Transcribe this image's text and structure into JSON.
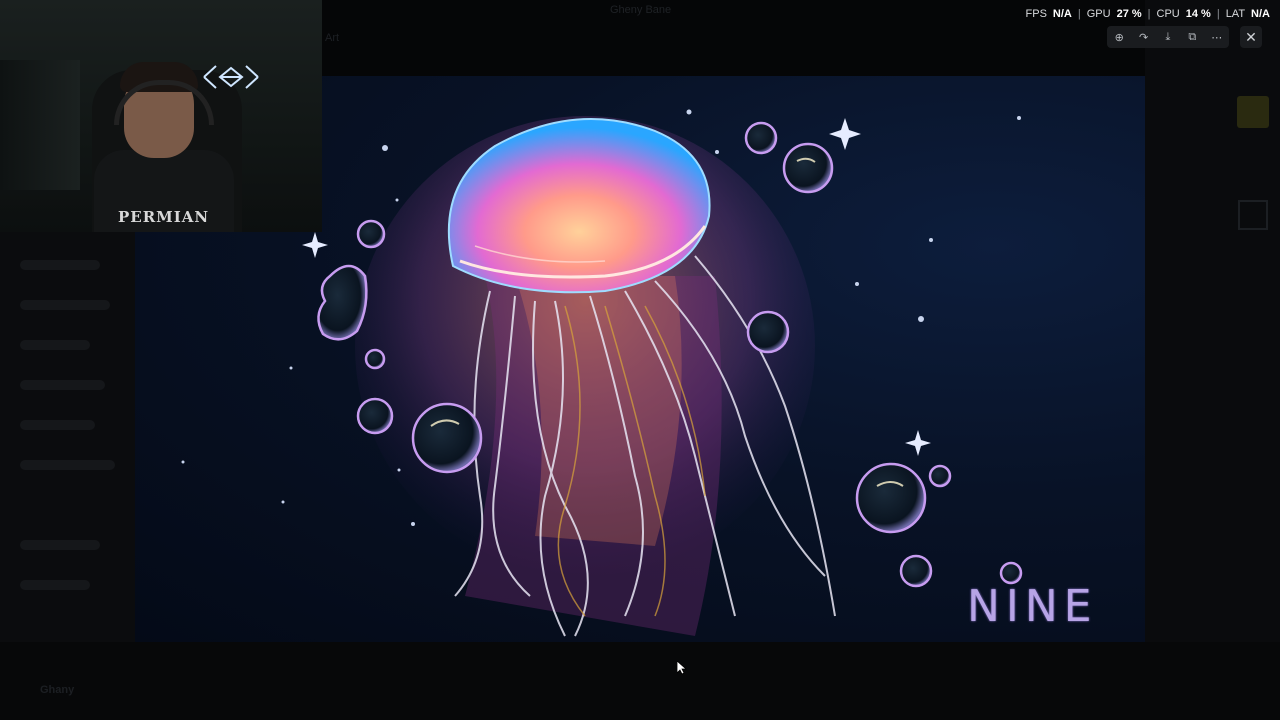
{
  "window": {
    "title": "Gheny Bane"
  },
  "stats": {
    "fps_label": "FPS",
    "fps_value": "N/A",
    "gpu_label": "GPU",
    "gpu_value": "27 %",
    "cpu_label": "CPU",
    "cpu_value": "14 %",
    "lat_label": "LAT",
    "lat_value": "N/A"
  },
  "viewer": {
    "tools": [
      {
        "name": "zoom-icon",
        "glyph": "⊕"
      },
      {
        "name": "forward-icon",
        "glyph": "↷"
      },
      {
        "name": "download-icon",
        "glyph": "⤓"
      },
      {
        "name": "open-external-icon",
        "glyph": "⧉"
      },
      {
        "name": "more-icon",
        "glyph": "⋯"
      }
    ],
    "close_glyph": "✕"
  },
  "background": {
    "channel": "Art",
    "user": "Ghany"
  },
  "webcam": {
    "shirt_text": "PERMIAN"
  },
  "artwork": {
    "signature": "NINE",
    "colors": {
      "bell_top": "#2aa6ff",
      "bell_mid": "#ff7ac8",
      "bell_core": "#ffb070",
      "bubble_rim": "#c79cf0"
    }
  }
}
